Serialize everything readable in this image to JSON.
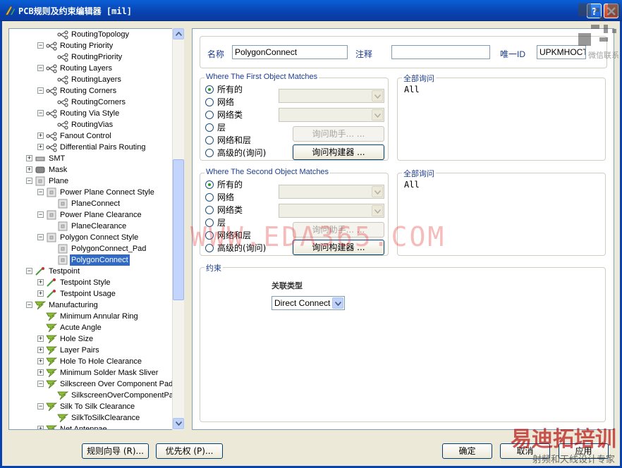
{
  "window": {
    "title": "PCB规则及约束编辑器 [mil]"
  },
  "tree": [
    {
      "depth": 3,
      "exp": "",
      "icon": "route",
      "label": "RoutingTopology",
      "sel": false
    },
    {
      "depth": 2,
      "exp": "-",
      "icon": "route",
      "label": "Routing Priority",
      "sel": false
    },
    {
      "depth": 3,
      "exp": "",
      "icon": "route",
      "label": "RoutingPriority",
      "sel": false
    },
    {
      "depth": 2,
      "exp": "-",
      "icon": "route",
      "label": "Routing Layers",
      "sel": false
    },
    {
      "depth": 3,
      "exp": "",
      "icon": "route",
      "label": "RoutingLayers",
      "sel": false
    },
    {
      "depth": 2,
      "exp": "-",
      "icon": "route",
      "label": "Routing Corners",
      "sel": false
    },
    {
      "depth": 3,
      "exp": "",
      "icon": "route",
      "label": "RoutingCorners",
      "sel": false
    },
    {
      "depth": 2,
      "exp": "-",
      "icon": "route",
      "label": "Routing Via Style",
      "sel": false
    },
    {
      "depth": 3,
      "exp": "",
      "icon": "route",
      "label": "RoutingVias",
      "sel": false
    },
    {
      "depth": 2,
      "exp": "+",
      "icon": "route",
      "label": "Fanout Control",
      "sel": false
    },
    {
      "depth": 2,
      "exp": "+",
      "icon": "route",
      "label": "Differential Pairs Routing",
      "sel": false
    },
    {
      "depth": 1,
      "exp": "+",
      "icon": "smt",
      "label": "SMT",
      "sel": false
    },
    {
      "depth": 1,
      "exp": "+",
      "icon": "mask",
      "label": "Mask",
      "sel": false
    },
    {
      "depth": 1,
      "exp": "-",
      "icon": "plane",
      "label": "Plane",
      "sel": false
    },
    {
      "depth": 2,
      "exp": "-",
      "icon": "plane",
      "label": "Power Plane Connect Style",
      "sel": false
    },
    {
      "depth": 3,
      "exp": "",
      "icon": "plane",
      "label": "PlaneConnect",
      "sel": false
    },
    {
      "depth": 2,
      "exp": "-",
      "icon": "plane",
      "label": "Power Plane Clearance",
      "sel": false
    },
    {
      "depth": 3,
      "exp": "",
      "icon": "plane",
      "label": "PlaneClearance",
      "sel": false
    },
    {
      "depth": 2,
      "exp": "-",
      "icon": "plane",
      "label": "Polygon Connect Style",
      "sel": false
    },
    {
      "depth": 3,
      "exp": "",
      "icon": "plane",
      "label": "PolygonConnect_Pad",
      "sel": false
    },
    {
      "depth": 3,
      "exp": "",
      "icon": "plane",
      "label": "PolygonConnect",
      "sel": true
    },
    {
      "depth": 1,
      "exp": "-",
      "icon": "test",
      "label": "Testpoint",
      "sel": false
    },
    {
      "depth": 2,
      "exp": "+",
      "icon": "test",
      "label": "Testpoint Style",
      "sel": false
    },
    {
      "depth": 2,
      "exp": "+",
      "icon": "test",
      "label": "Testpoint Usage",
      "sel": false
    },
    {
      "depth": 1,
      "exp": "-",
      "icon": "mfg",
      "label": "Manufacturing",
      "sel": false
    },
    {
      "depth": 2,
      "exp": "",
      "icon": "mfg",
      "label": "Minimum Annular Ring",
      "sel": false
    },
    {
      "depth": 2,
      "exp": "",
      "icon": "mfg",
      "label": "Acute Angle",
      "sel": false
    },
    {
      "depth": 2,
      "exp": "+",
      "icon": "mfg",
      "label": "Hole Size",
      "sel": false
    },
    {
      "depth": 2,
      "exp": "+",
      "icon": "mfg",
      "label": "Layer Pairs",
      "sel": false
    },
    {
      "depth": 2,
      "exp": "+",
      "icon": "mfg",
      "label": "Hole To Hole Clearance",
      "sel": false
    },
    {
      "depth": 2,
      "exp": "+",
      "icon": "mfg",
      "label": "Minimum Solder Mask Sliver",
      "sel": false
    },
    {
      "depth": 2,
      "exp": "-",
      "icon": "mfg",
      "label": "Silkscreen Over Component Pads",
      "sel": false
    },
    {
      "depth": 3,
      "exp": "",
      "icon": "mfg",
      "label": "SilkscreenOverComponentPac",
      "sel": false
    },
    {
      "depth": 2,
      "exp": "-",
      "icon": "mfg",
      "label": "Silk To Silk Clearance",
      "sel": false
    },
    {
      "depth": 3,
      "exp": "",
      "icon": "mfg",
      "label": "SilkToSilkClearance",
      "sel": false
    },
    {
      "depth": 2,
      "exp": "+",
      "icon": "mfg",
      "label": "Net Antennae",
      "sel": false
    }
  ],
  "rule": {
    "name_label": "名称",
    "name_value": "PolygonConnect",
    "comment_label": "注释",
    "comment_value": "",
    "uid_label": "唯一ID",
    "uid_value": "UPKMHOCT"
  },
  "first_match": {
    "caption": "Where The First Object Matches",
    "options": [
      "所有的",
      "网络",
      "网络类",
      "层",
      "网络和层",
      "高级的(询问)"
    ],
    "selected": 0,
    "query_helper": "询问助手... ...",
    "query_builder": "询问构建器 ...",
    "full_query_caption": "全部询问",
    "full_query": "All"
  },
  "second_match": {
    "caption": "Where The Second Object Matches",
    "options": [
      "所有的",
      "网络",
      "网络类",
      "层",
      "网络和层",
      "高级的(询问)"
    ],
    "selected": 0,
    "query_helper": "询问助手... ...",
    "query_builder": "询问构建器 ...",
    "full_query_caption": "全部询问",
    "full_query": "All"
  },
  "constraints": {
    "caption": "约束",
    "connect_type_label": "关联类型",
    "connect_type_value": "Direct Connect"
  },
  "footer": {
    "wizard": "规则向导 (R)...",
    "priority": "优先权 (P)...",
    "ok": "确定",
    "cancel": "取消",
    "apply": "应用"
  },
  "watermark": {
    "eda": "WWW.EDA365.COM",
    "logo": "易迪拓培训",
    "logo_sub": "射频和天线设计专家",
    "qr_sub": "微信联系"
  },
  "colors": {
    "selection": "#316ac5",
    "caption_blue": "#1c3d8f"
  }
}
